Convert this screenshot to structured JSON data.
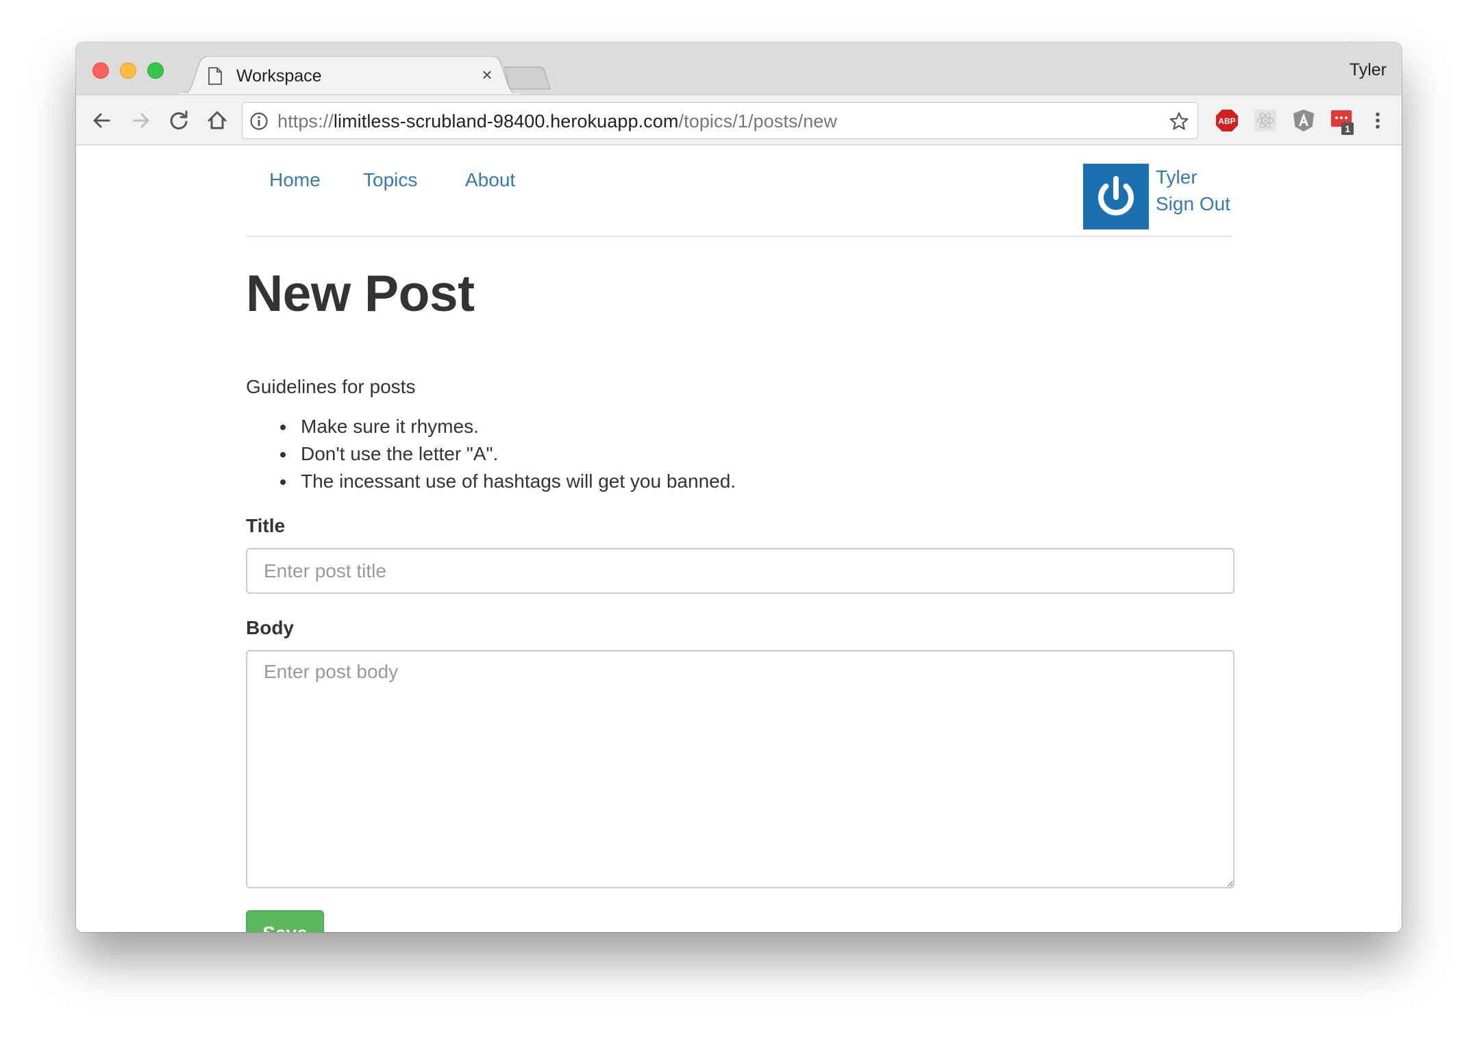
{
  "browser": {
    "tab_title": "Workspace",
    "tab_close": "×",
    "profile_name": "Tyler",
    "url_scheme": "https://",
    "url_host": "limitless-scrubland-98400.herokuapp.com",
    "url_path": "/topics/1/posts/new",
    "extensions": [
      {
        "name": "adblock-plus",
        "label": "ABP",
        "color": "#d1201d"
      },
      {
        "name": "react-devtools",
        "color": "#cfcfcf"
      },
      {
        "name": "angular-batarang",
        "label": "A",
        "color": "#8d8d8d"
      },
      {
        "name": "notification-extension",
        "badge": "1",
        "color": "#e53935"
      }
    ]
  },
  "nav": {
    "home": "Home",
    "topics": "Topics",
    "about": "About",
    "user_name": "Tyler",
    "sign_out": "Sign Out",
    "avatar_color": "#1a70b0"
  },
  "main": {
    "title": "New Post",
    "guidelines_heading": "Guidelines for posts",
    "guidelines": [
      "Make sure it rhymes.",
      "Don't use the letter \"A\".",
      "The incessant use of hashtags will get you banned."
    ]
  },
  "form": {
    "title_label": "Title",
    "title_placeholder": "Enter post title",
    "title_value": "",
    "body_label": "Body",
    "body_placeholder": "Enter post body",
    "body_value": "",
    "save_label": "Save",
    "save_color": "#5cb85c"
  },
  "colors": {
    "link": "#337ab7",
    "text": "#333333"
  }
}
